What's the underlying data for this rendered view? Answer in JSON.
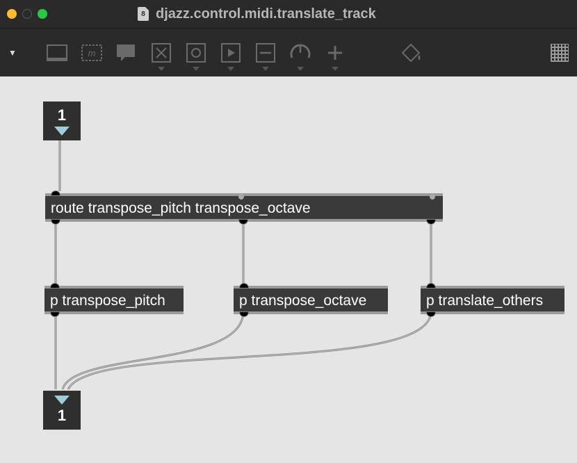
{
  "window": {
    "title": "djazz.control.midi.translate_track"
  },
  "numbox_in": {
    "value": "1"
  },
  "numbox_out": {
    "value": "1"
  },
  "route": {
    "text": "route transpose_pitch transpose_octave"
  },
  "sub1": {
    "text": "p transpose_pitch"
  },
  "sub2": {
    "text": "p transpose_octave"
  },
  "sub3": {
    "text": "p translate_others"
  }
}
